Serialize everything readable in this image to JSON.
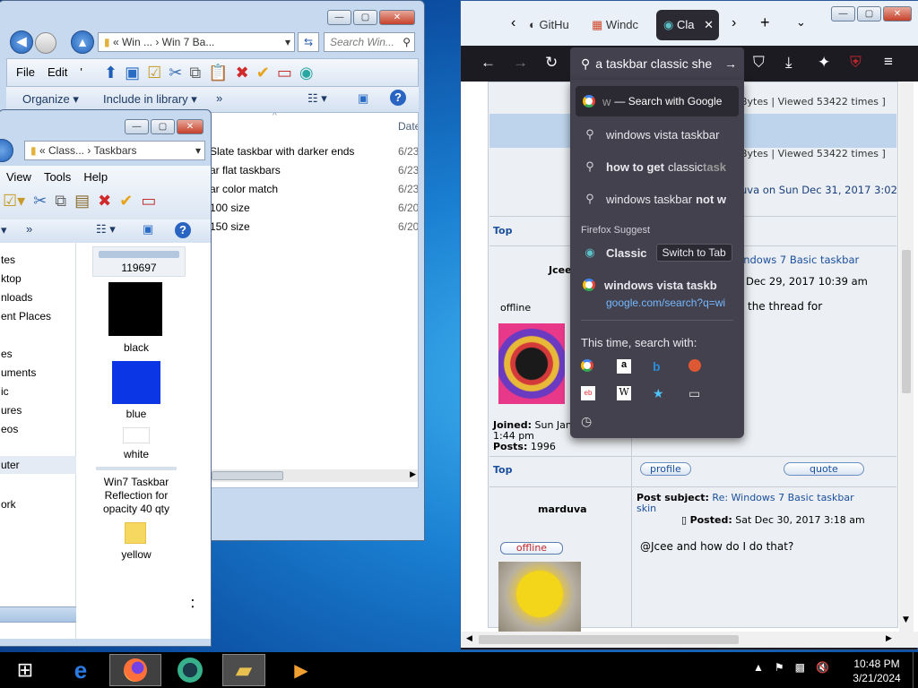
{
  "explorer_back": {
    "address": [
      "«",
      "Win ...",
      "Win 7 Ba...",
      ""
    ],
    "search_placeholder": "Search Win...",
    "menu": [
      "File",
      "Edit",
      "'"
    ],
    "toolbar": {
      "organize": "Organize",
      "include": "Include in library",
      "more": "»"
    },
    "date_header": "Date",
    "files": [
      {
        "name": "Slate taskbar with darker ends",
        "date": "6/23"
      },
      {
        "name": "ar flat taskbars",
        "date": "6/23"
      },
      {
        "name": "ar color match",
        "date": "6/23"
      },
      {
        "name": "100 size",
        "date": "6/20"
      },
      {
        "name": "150 size",
        "date": "6/20"
      }
    ]
  },
  "explorer_front": {
    "address": [
      "«",
      "Class...",
      "›",
      "Taskbars"
    ],
    "menu": [
      "View",
      "Tools",
      "Help"
    ],
    "nav_items": [
      "tes",
      "ktop",
      "nloads",
      "ent Places",
      "",
      "es",
      "uments",
      "ic",
      "ures",
      "eos",
      "",
      "uter",
      "",
      "ork"
    ],
    "thumbnails": [
      {
        "label": "119697",
        "color": "#b3c8de"
      },
      {
        "label": "black",
        "color": "#000000"
      },
      {
        "label": "blue",
        "color": "#0a36e6"
      },
      {
        "label": "white",
        "color": "#ffffff"
      },
      {
        "label": "Win7 Taskbar Reflection for opacity 40 qty",
        "color": "#d6e0ea"
      },
      {
        "label": "yellow",
        "color": "#f6d860"
      }
    ],
    "more": "»"
  },
  "firefox": {
    "tabs": [
      {
        "label": "GitHu",
        "icon": "github-icon"
      },
      {
        "label": "Windc",
        "icon": "windows-icon"
      },
      {
        "label": "Cla",
        "icon": "globe-icon",
        "active": true
      }
    ],
    "url_text": "a taskbar classic she",
    "dropdown": {
      "first": {
        "prefix": "w",
        "action": "— Search with Google"
      },
      "suggestions": [
        {
          "text": "windows vista taskbar",
          "bold": ""
        },
        {
          "text": "how to get ",
          "bold": "classic",
          "rest": " task"
        },
        {
          "text": "windows taskbar ",
          "bold": "not w",
          "rest": ""
        }
      ],
      "firefox_suggest_label": "Firefox Suggest",
      "classic_item": "Classic",
      "switch_tab": "Switch to Tab",
      "vista_item": "windows vista taskb",
      "vista_url": "google.com/search?q=wi",
      "this_time": "This time, search with:"
    },
    "forum": {
      "bytes_text": "Bytes | Viewed 53422 times ]",
      "bytes_text2": "Bytes | Viewed 53422 times ]",
      "by_text": "uva on Sun Dec 31, 2017 3:02",
      "top": "Top",
      "post1": {
        "author": "Jcee",
        "subject_link": "indows 7 Basic taskbar",
        "posted": "Dec 29, 2017 10:39 am",
        "body": "the thread for",
        "status": "offline",
        "joined_label": "Joined:",
        "joined": "Sun Jan",
        "joined2": "1:44 pm",
        "posts_label": "Posts:",
        "posts": "1996",
        "profile": "profile",
        "quote": "quote"
      },
      "post2": {
        "author": "marduva",
        "subject_label": "Post subject:",
        "subject_link": "Re: Windows 7 Basic taskbar skin",
        "posted_label": "Posted:",
        "posted": "Sat Dec 30, 2017 3:18 am",
        "body": "@Jcee and how do I do that?",
        "status": "offline"
      }
    }
  },
  "taskbar": {
    "time": "10:48 PM",
    "date": "3/21/2024"
  }
}
